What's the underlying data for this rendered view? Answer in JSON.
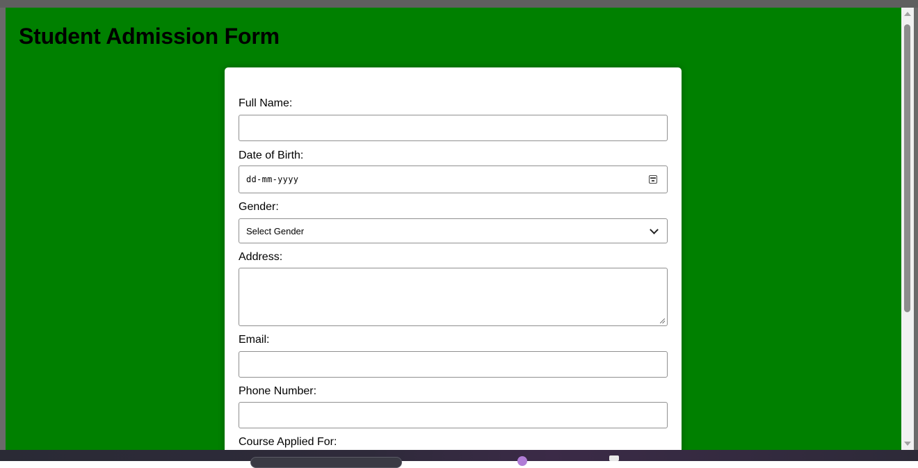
{
  "page": {
    "title": "Student Admission Form",
    "background_color": "#008000"
  },
  "form": {
    "full_name": {
      "label": "Full Name:",
      "value": ""
    },
    "dob": {
      "label": "Date of Birth:",
      "placeholder": "dd-mm-yyyy",
      "icon": "calendar-icon"
    },
    "gender": {
      "label": "Gender:",
      "selected": "Select Gender",
      "icon": "chevron-down-icon"
    },
    "address": {
      "label": "Address:",
      "value": ""
    },
    "email": {
      "label": "Email:",
      "value": ""
    },
    "phone": {
      "label": "Phone Number:",
      "value": ""
    },
    "course": {
      "label": "Course Applied For:"
    }
  }
}
